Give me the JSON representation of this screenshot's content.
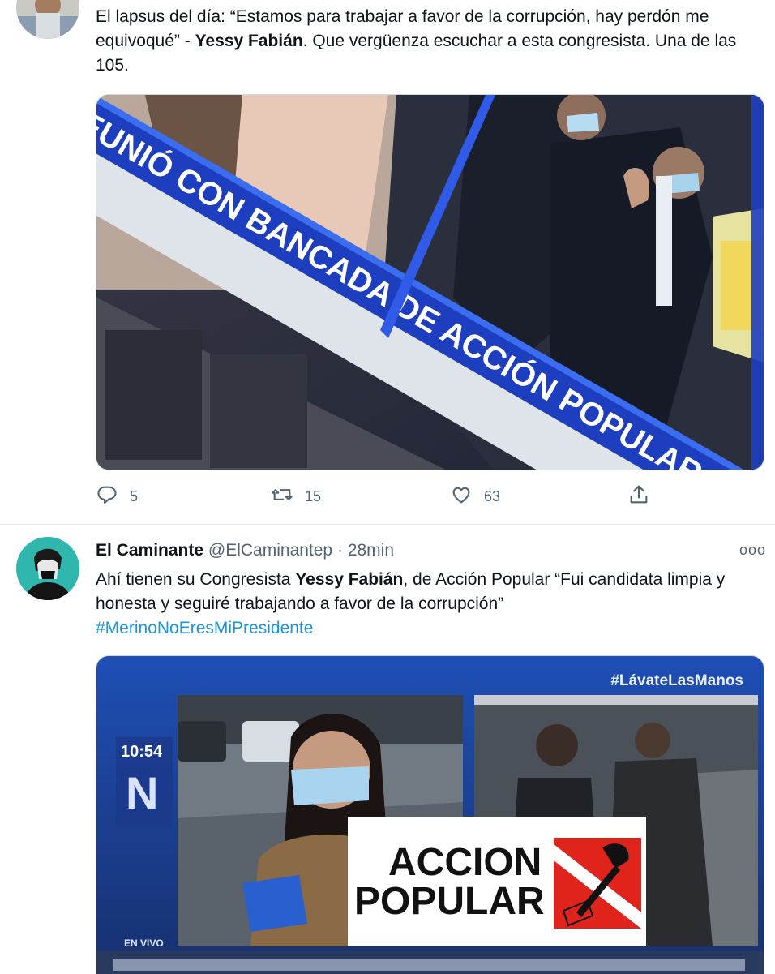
{
  "tweet1": {
    "text_pre": "El lapsus del día: “Estamos para trabajar a favor de la corrupción, hay perdón me equivoqué” - ",
    "text_bold": "Yessy Fabián",
    "text_post": ". Que vergüenza escuchar a esta congresista. Una de las 105.",
    "media": {
      "chyron": "EUNIÓ CON BANCADA DE ACCIÓN POPULAR EN EL CONGRE"
    },
    "actions": {
      "replies": "5",
      "retweets": "15",
      "likes": "63"
    }
  },
  "tweet2": {
    "name": "El Caminante",
    "handle": "@ElCaminantep",
    "separator": "·",
    "time": "28min",
    "more": "ooo",
    "text_pre": "Ahí tienen su Congresista ",
    "text_bold": "Yessy Fabián",
    "text_post": ", de Acción Popular “Fui candidata limpia y honesta y seguiré trabajando a favor de la corrupción”",
    "hashtag": "#MerinoNoEresMiPresidente",
    "media": {
      "tag": "#LávateLasManos",
      "clock": "10:54",
      "channel": "N",
      "live": "EN VIVO",
      "logo_line1": "ACCION",
      "logo_line2": "POPULAR"
    }
  },
  "colors": {
    "link": "#1b95e0",
    "muted": "#536471",
    "chyron_blue": "#1d3fbf"
  },
  "icons": [
    "reply-icon",
    "retweet-icon",
    "like-icon",
    "share-icon",
    "more-options-icon"
  ]
}
